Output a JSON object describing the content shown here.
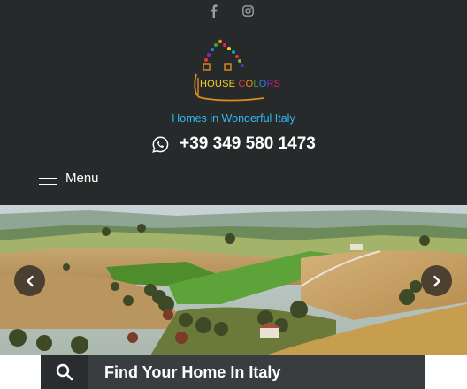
{
  "header": {
    "social": [
      {
        "icon": "facebook-icon"
      },
      {
        "icon": "instagram-icon"
      }
    ],
    "logo": {
      "letters": [
        {
          "ch": "H",
          "color": "#f4d021"
        },
        {
          "ch": "O",
          "color": "#f4d021"
        },
        {
          "ch": "U",
          "color": "#f4d021"
        },
        {
          "ch": "S",
          "color": "#f4d021"
        },
        {
          "ch": "E",
          "color": "#f4d021"
        },
        {
          "ch": " ",
          "color": "#f4d021"
        },
        {
          "ch": "C",
          "color": "#e53935"
        },
        {
          "ch": "O",
          "color": "#fb8c00"
        },
        {
          "ch": "L",
          "color": "#43a047"
        },
        {
          "ch": "O",
          "color": "#1e88e5"
        },
        {
          "ch": "R",
          "color": "#8e24aa"
        },
        {
          "ch": "S",
          "color": "#e91e63"
        }
      ]
    },
    "tagline": "Homes in Wonderful Italy",
    "phone": "+39 349 580 1473",
    "menu_label": "Menu"
  },
  "slider": {
    "prev_icon": "chevron-left-icon",
    "next_icon": "chevron-right-icon"
  },
  "search": {
    "icon": "search-icon",
    "label": "Find Your Home In Italy"
  },
  "colors": {
    "header_bg": "#262a2b",
    "tagline": "#35b7f0",
    "search_bar": "#393d3f"
  }
}
